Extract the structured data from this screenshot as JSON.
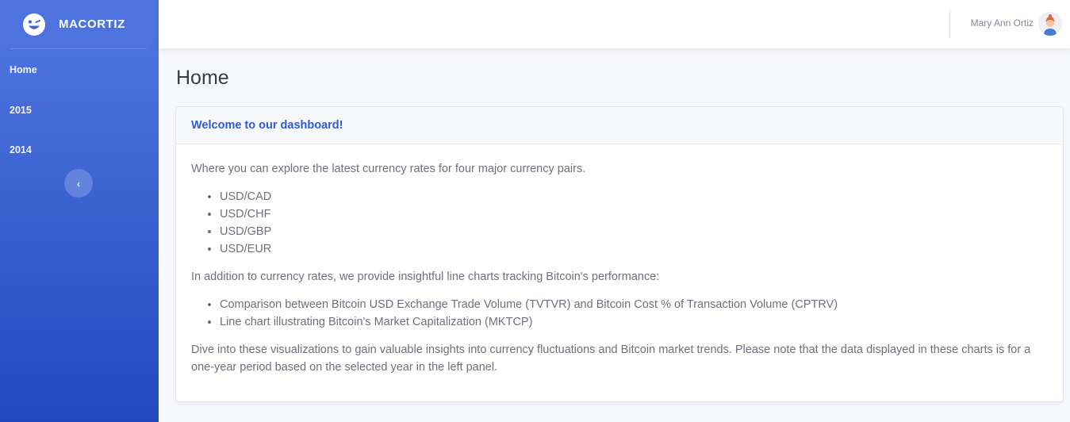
{
  "brand": {
    "name": "MACORTIZ",
    "icon": "laugh-wink-icon"
  },
  "sidebar": {
    "items": [
      {
        "label": "Home"
      },
      {
        "label": "2015"
      },
      {
        "label": "2014"
      }
    ],
    "toggle_icon": "chevron-left-icon",
    "toggle_glyph": "‹"
  },
  "topbar": {
    "user_name": "Mary Ann Ortiz",
    "avatar_icon": "user-avatar-icon"
  },
  "page": {
    "title": "Home"
  },
  "card": {
    "title": "Welcome to our dashboard!",
    "intro": "Where you can explore the latest currency rates for four major currency pairs.",
    "pairs": [
      "USD/CAD",
      "USD/CHF",
      "USD/GBP",
      "USD/EUR"
    ],
    "charts_intro": "In addition to currency rates, we provide insightful line charts tracking Bitcoin's performance:",
    "charts": [
      "Comparison between Bitcoin USD Exchange Trade Volume (TVTVR) and Bitcoin Cost % of Transaction Volume (CPTRV)",
      "Line chart illustrating Bitcoin's Market Capitalization (MKTCP)"
    ],
    "outro": "Dive into these visualizations to gain valuable insights into currency fluctuations and Bitcoin market trends. Please note that the data displayed in these charts is for a one-year period based on the selected year in the left panel."
  },
  "colors": {
    "sidebar_top": "#4e73df",
    "sidebar_bottom": "#224abe",
    "accent": "#2e59d9"
  }
}
